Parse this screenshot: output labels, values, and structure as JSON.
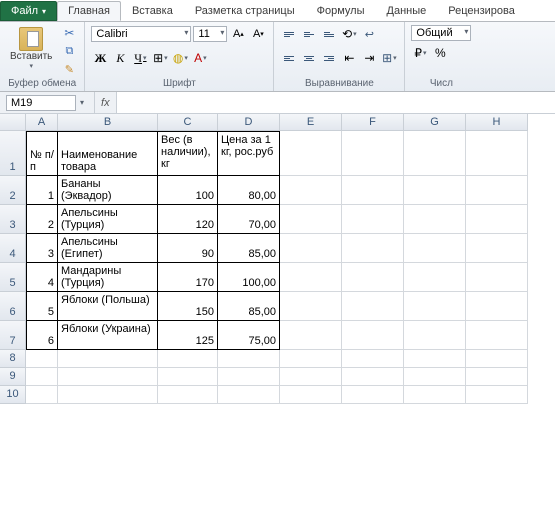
{
  "tabs": {
    "file": "Файл",
    "items": [
      "Главная",
      "Вставка",
      "Разметка страницы",
      "Формулы",
      "Данные",
      "Рецензирова"
    ]
  },
  "ribbon": {
    "clipboard": {
      "paste": "Вставить",
      "label": "Буфер обмена"
    },
    "font": {
      "name": "Calibri",
      "size": "11",
      "bold": "Ж",
      "italic": "К",
      "underline": "Ч",
      "label": "Шрифт"
    },
    "align": {
      "label": "Выравнивание"
    },
    "number": {
      "format": "Общий",
      "label": "Числ"
    }
  },
  "namebox": "M19",
  "formula": "",
  "cols": [
    "A",
    "B",
    "C",
    "D",
    "E",
    "F",
    "G",
    "H"
  ],
  "rows": [
    "1",
    "2",
    "3",
    "4",
    "5",
    "6",
    "7",
    "8",
    "9",
    "10"
  ],
  "header": {
    "a": "№ п/п",
    "b": "Наименование товара",
    "c": "Вес (в наличии), кг",
    "d": "Цена за 1 кг, рос.руб"
  },
  "data": [
    {
      "n": "1",
      "name": "Бананы (Эквадор)",
      "w": "100",
      "p": "80,00"
    },
    {
      "n": "2",
      "name": "Апельсины (Турция)",
      "w": "120",
      "p": "70,00"
    },
    {
      "n": "3",
      "name": "Апельсины (Египет)",
      "w": "90",
      "p": "85,00"
    },
    {
      "n": "4",
      "name": "Мандарины (Турция)",
      "w": "170",
      "p": "100,00"
    },
    {
      "n": "5",
      "name": "Яблоки (Польша)",
      "w": "150",
      "p": "85,00"
    },
    {
      "n": "6",
      "name": "Яблоки (Украина)",
      "w": "125",
      "p": "75,00"
    }
  ]
}
